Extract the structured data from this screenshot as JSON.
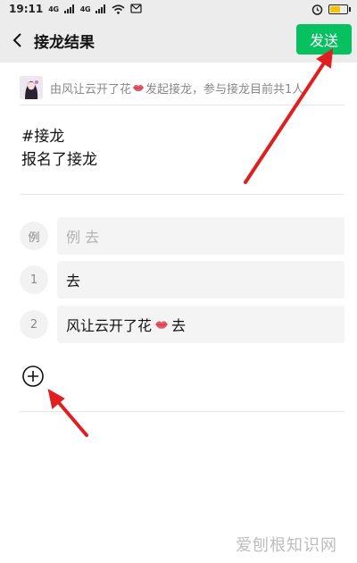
{
  "status_bar": {
    "time": "19:11",
    "signal_1": "4G",
    "signal_2": "4G"
  },
  "header": {
    "title": "接龙结果",
    "send_label": "发送"
  },
  "initiator": {
    "name": "由风让云开了花",
    "suffix": "发起接龙，参与接龙目前共1人"
  },
  "topic": {
    "line1": "#接龙",
    "line2": "报名了接龙"
  },
  "entries": [
    {
      "num": "例",
      "text": "例 去"
    },
    {
      "num": "1",
      "text": "去"
    },
    {
      "num": "2",
      "text": "风让云开了花",
      "suffix": "去"
    }
  ],
  "watermark": "爱刨根知识网",
  "colors": {
    "accent": "#07c160",
    "arrow": "#e02020"
  }
}
